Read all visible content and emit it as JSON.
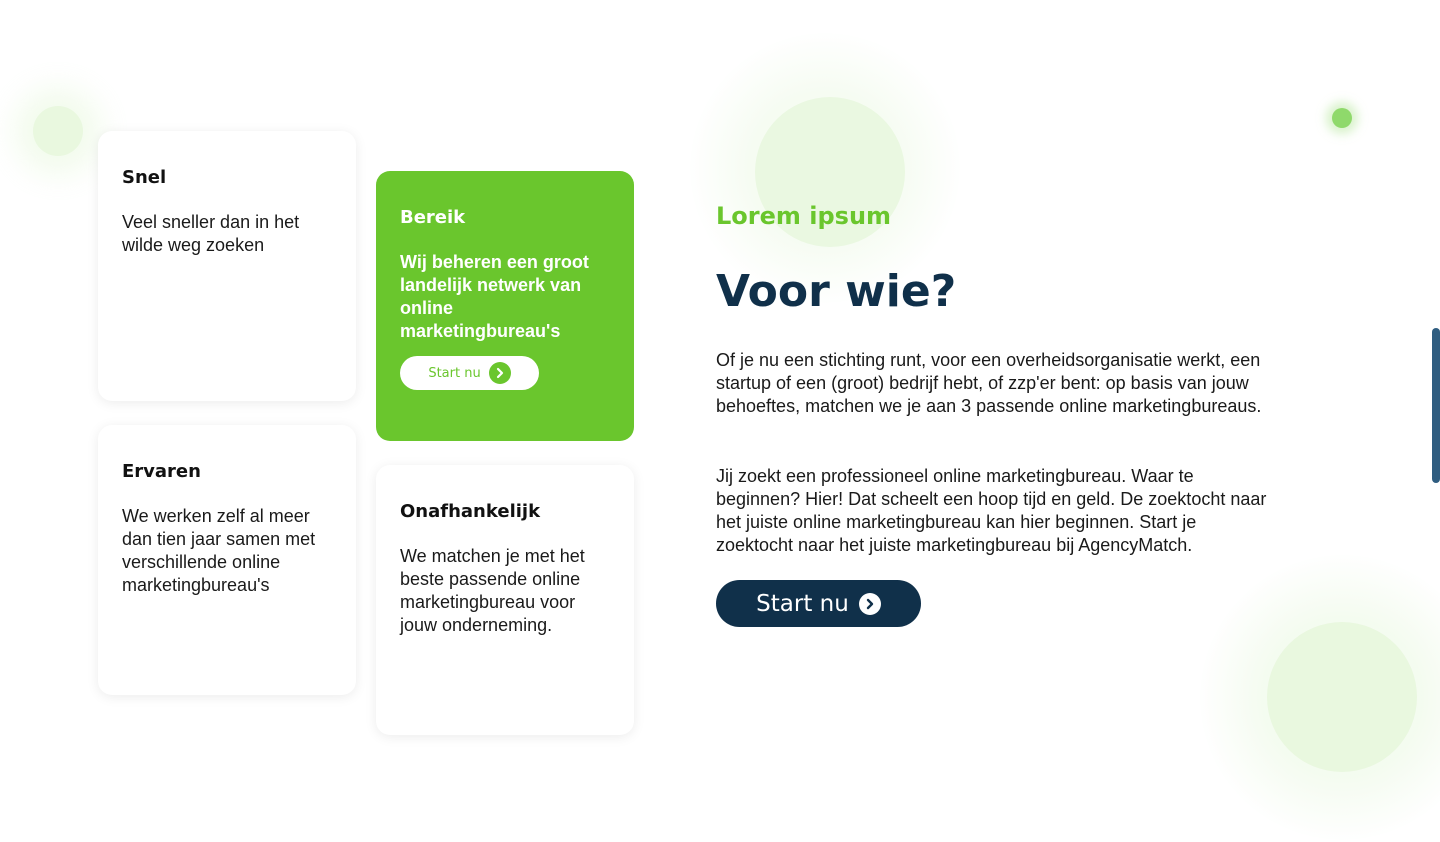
{
  "cards": [
    {
      "title": "Snel",
      "text": "Veel sneller dan in het wilde weg zoeken"
    },
    {
      "title": "Bereik",
      "text": "Wij beheren een groot landelijk netwerk van online marketingbureau's",
      "button_label": "Start nu",
      "button_icon": "chevron-right-icon"
    },
    {
      "title": "Ervaren",
      "text": "We werken zelf al meer dan tien jaar samen met verschillende online marketingbureau's"
    },
    {
      "title": "Onafhankelijk",
      "text": "We matchen je met het beste passende online marketingbureau voor jouw onderneming."
    }
  ],
  "section": {
    "eyebrow": "Lorem ipsum",
    "heading": "Voor wie?",
    "paragraph_1": "Of je nu een stichting runt, voor een overheidsorganisatie werkt, een startup of een (groot) bedrijf hebt, of zzp'er bent: op basis van jouw behoeftes, matchen we je aan 3 passende online marketingbureaus.",
    "paragraph_2": "Jij zoekt een professioneel online marketingbureau. Waar te beginnen? Hier! Dat scheelt een hoop tijd en geld. De zoektocht naar het juiste online marketingbureau kan hier beginnen. Start je zoektocht naar het juiste marketingbureau bij AgencyMatch.",
    "button_label": "Start nu",
    "button_icon": "chevron-right-icon"
  },
  "colors": {
    "accent_green": "#6ac62d",
    "navy": "#10304a",
    "light_green": "#e9f8df",
    "scrollbar": "#2f5d80"
  }
}
